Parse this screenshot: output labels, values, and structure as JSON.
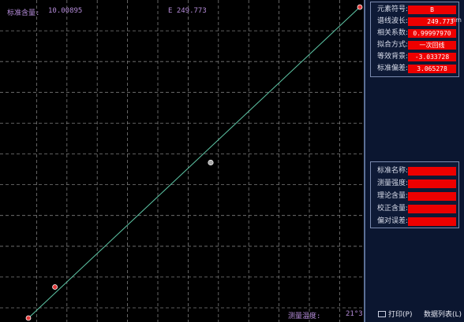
{
  "plot": {
    "std_content_label": "标准含量:",
    "std_content_value": "10.00895",
    "e_value": "E 249.773",
    "temp_label": "测量温度:",
    "temp_value": "21°3"
  },
  "info_panel": {
    "rows": [
      {
        "label": "元素符号:",
        "value": "B"
      },
      {
        "label": "谱线波长:",
        "value": "249.773",
        "unit": "nm"
      },
      {
        "label": "相关系数:",
        "value": "0.99997970"
      },
      {
        "label": "拟合方式:",
        "value": "一次回线"
      },
      {
        "label": "等效背景:",
        "value": "-3.033728"
      },
      {
        "label": "标准偏差:",
        "value": "3.065278"
      }
    ]
  },
  "sample_panel": {
    "rows": [
      {
        "label": "标准名称:",
        "value": ""
      },
      {
        "label": "测量强度:",
        "value": ""
      },
      {
        "label": "理论含量:",
        "value": ""
      },
      {
        "label": "校正含量:",
        "value": ""
      },
      {
        "label": "偏对误差:",
        "value": ""
      }
    ]
  },
  "buttons": {
    "print_label": "打印(P)",
    "data_list_label": "数据列表(L)"
  },
  "colors": {
    "grid": "#7c7c7c",
    "fit_line": "#5fc9a8",
    "std_point": "#e23b3b",
    "sample_point": "#a8a8a8",
    "value_box": "#ee0000",
    "label_text": "#b48bd8"
  },
  "chart_data": {
    "type": "scatter",
    "title": "",
    "xlabel": "",
    "ylabel": "",
    "grid": true,
    "standard_points": [
      {
        "x": 0.0,
        "y": 0.0
      },
      {
        "x": 0.08,
        "y": 0.1
      },
      {
        "x": 1.0,
        "y": 1.0
      }
    ],
    "measured_point": {
      "x": 0.55,
      "y": 0.5
    },
    "fit_line": {
      "x": [
        0.0,
        1.0
      ],
      "y": [
        0.0,
        1.0
      ]
    }
  }
}
